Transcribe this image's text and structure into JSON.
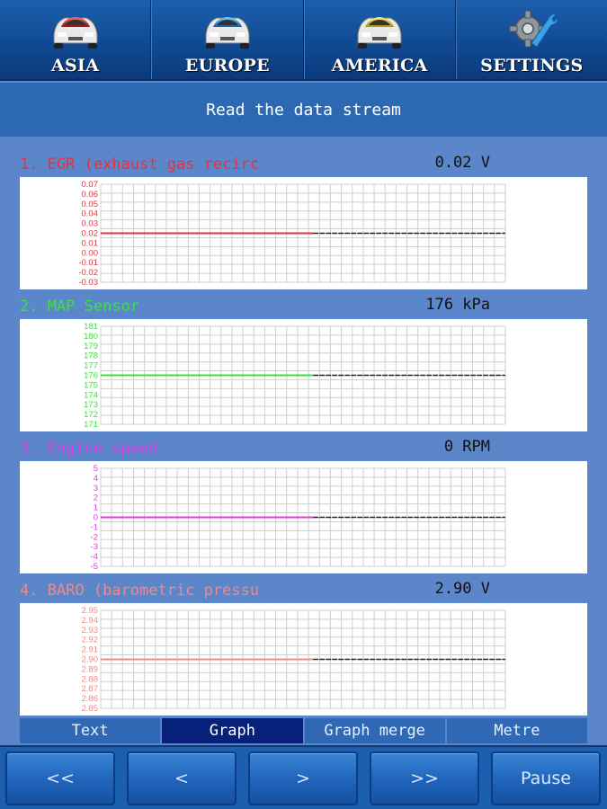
{
  "top_tabs": [
    {
      "label": "ASIA",
      "icon": "car-red-icon",
      "color": "#d92a2a"
    },
    {
      "label": "EUROPE",
      "icon": "car-blue-icon",
      "color": "#2a8ad9"
    },
    {
      "label": "AMERICA",
      "icon": "car-yellow-icon",
      "color": "#d9c22a"
    },
    {
      "label": "SETTINGS",
      "icon": "settings-gear-wrench-icon",
      "color": "#9aa3ad"
    }
  ],
  "title": "Read the data stream",
  "sensors": [
    {
      "name": "1. EGR (exhaust gas recirc",
      "value": "0.02 V",
      "color": "#e8303f",
      "y_ticks": [
        "0.07",
        "0.06",
        "0.05",
        "0.04",
        "0.03",
        "0.02",
        "0.01",
        "0.00",
        "-0.01",
        "-0.02",
        "-0.03"
      ],
      "level": 0.02,
      "ymin": -0.03,
      "ymax": 0.07
    },
    {
      "name": "2. MAP Sensor",
      "value": "176 kPa",
      "color": "#39e23c",
      "y_ticks": [
        "181",
        "180",
        "179",
        "178",
        "177",
        "176",
        "175",
        "174",
        "173",
        "172",
        "171"
      ],
      "level": 176,
      "ymin": 171,
      "ymax": 181
    },
    {
      "name": "3. Engine speed",
      "value": "0 RPM",
      "color": "#e23ae6",
      "y_ticks": [
        "5",
        "4",
        "3",
        "2",
        "1",
        "0",
        "-1",
        "-2",
        "-3",
        "-4",
        "-5"
      ],
      "level": 0,
      "ymin": -5,
      "ymax": 5
    },
    {
      "name": "4. BARO (barometric pressu",
      "value": "2.90 V",
      "color": "#f08a86",
      "y_ticks": [
        "2.95",
        "2.94",
        "2.93",
        "2.92",
        "2.91",
        "2.90",
        "2.89",
        "2.88",
        "2.87",
        "2.86",
        "2.85"
      ],
      "level": 2.9,
      "ymin": 2.85,
      "ymax": 2.95
    }
  ],
  "mode_tabs": [
    {
      "label": "Text",
      "active": false
    },
    {
      "label": "Graph",
      "active": true
    },
    {
      "label": "Graph merge",
      "active": false
    },
    {
      "label": "Metre",
      "active": false
    }
  ],
  "nav_buttons": {
    "first": "<<",
    "prev": "<",
    "next": ">",
    "last": ">>",
    "pause": "Pause"
  }
}
